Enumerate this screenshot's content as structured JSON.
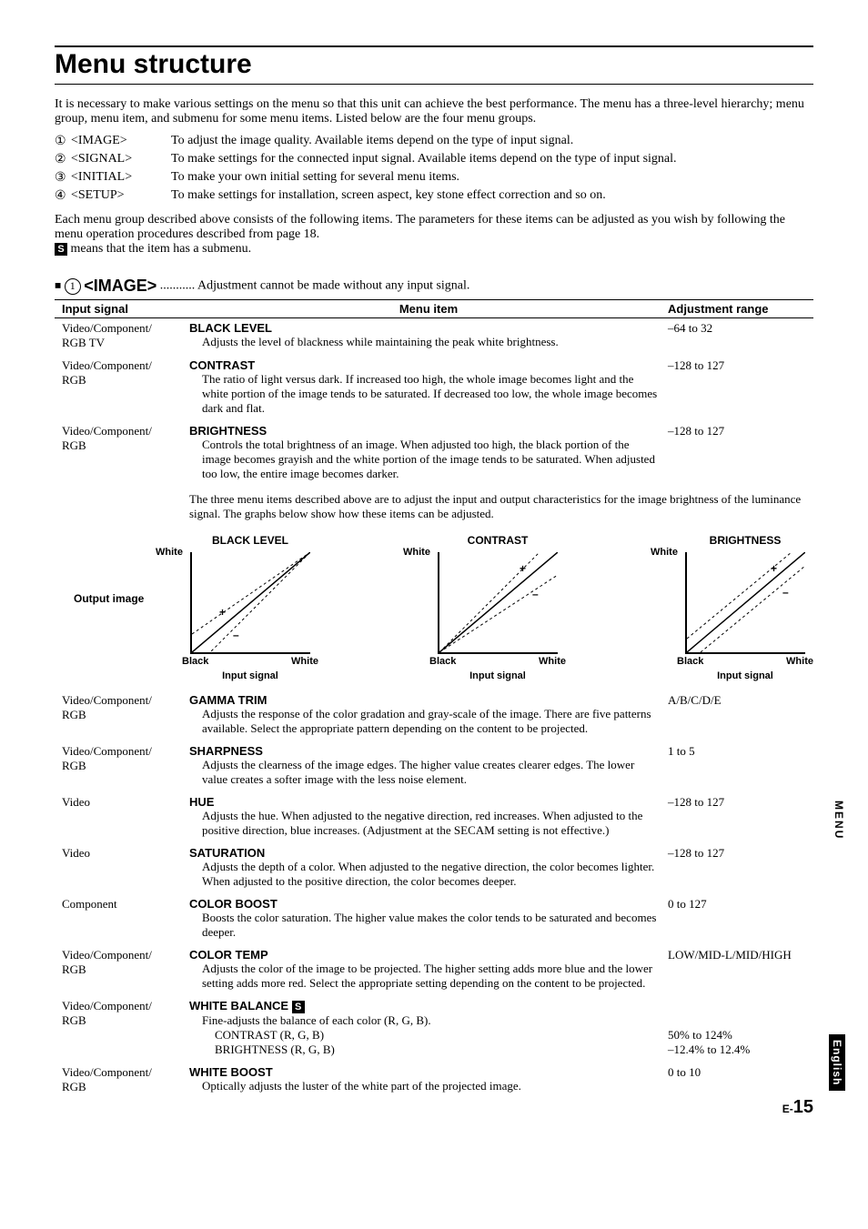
{
  "title": "Menu structure",
  "intro1": "It is necessary to make various settings on the menu so that this unit can achieve the best performance. The menu has a three-level hierarchy; menu group, menu item, and submenu for some menu items. Listed below are the four menu groups.",
  "groups": [
    {
      "num": "①",
      "tag": "<IMAGE>",
      "desc": "To adjust the image quality. Available items depend on the type of input signal."
    },
    {
      "num": "②",
      "tag": "<SIGNAL>",
      "desc": "To make settings for the connected input signal. Available items depend on the type of input signal."
    },
    {
      "num": "③",
      "tag": "<INITIAL>",
      "desc": "To make your own initial setting for several menu items."
    },
    {
      "num": "④",
      "tag": "<SETUP>",
      "desc": "To make settings for installation, screen aspect, key stone effect correction and so on."
    }
  ],
  "post1": "Each menu group described above consists of the following items. The parameters for these items can be adjusted as you wish by following the menu operation procedures described from page 18.",
  "post2": " means that the item has a submenu.",
  "section": {
    "num": "①",
    "name": "<IMAGE>",
    "dots": "...........",
    "note": "Adjustment cannot be made without any input signal."
  },
  "thead": {
    "c1": "Input signal",
    "c2": "Menu item",
    "c3": "Adjustment range"
  },
  "rows1": [
    {
      "input": "Video/Component/\nRGB TV",
      "title": "BLACK LEVEL",
      "desc": "Adjusts the level of blackness while maintaining the peak white brightness.",
      "range": "–64 to 32"
    },
    {
      "input": "Video/Component/\nRGB",
      "title": "CONTRAST",
      "desc": "The ratio of light versus dark. If increased too high, the whole image becomes light and the white portion of the image tends to be saturated. If decreased too low, the whole image becomes dark and flat.",
      "range": "–128 to 127"
    },
    {
      "input": "Video/Component/\nRGB",
      "title": "BRIGHTNESS",
      "desc": "Controls the total brightness of an image. When adjusted too high, the black portion of the image becomes grayish and the white portion of the image tends to be saturated. When adjusted too low, the entire image becomes darker.",
      "range": "–128 to 127"
    }
  ],
  "midnote": "The three menu items described above are to adjust the input and output characteristics for the image brightness of the luminance signal. The graphs below show how these items can be adjusted.",
  "chart_data": [
    {
      "type": "line",
      "title": "BLACK LEVEL",
      "xlabel": "Input signal",
      "ylabel": "Output image",
      "x": [
        "Black",
        "White"
      ],
      "ylim": [
        "Black",
        "White"
      ],
      "series": [
        {
          "name": "+",
          "values": [
            0.2,
            1.0
          ]
        },
        {
          "name": "base",
          "values": [
            0.0,
            1.0
          ]
        },
        {
          "name": "–",
          "values": [
            -0.2,
            1.0
          ]
        }
      ]
    },
    {
      "type": "line",
      "title": "CONTRAST",
      "xlabel": "Input signal",
      "ylabel": "",
      "x": [
        "Black",
        "White"
      ],
      "ylim": [
        "Black",
        "White"
      ],
      "series": [
        {
          "name": "+",
          "values": [
            0.0,
            1.2
          ]
        },
        {
          "name": "base",
          "values": [
            0.0,
            1.0
          ]
        },
        {
          "name": "–",
          "values": [
            0.0,
            0.8
          ]
        }
      ]
    },
    {
      "type": "line",
      "title": "BRIGHTNESS",
      "xlabel": "Input signal",
      "ylabel": "",
      "x": [
        "Black",
        "White"
      ],
      "ylim": [
        "Black",
        "White"
      ],
      "series": [
        {
          "name": "+",
          "values": [
            0.2,
            1.2
          ]
        },
        {
          "name": "base",
          "values": [
            0.0,
            1.0
          ]
        },
        {
          "name": "–",
          "values": [
            -0.2,
            0.8
          ]
        }
      ]
    }
  ],
  "charts": {
    "outLabel": "Output image",
    "white": "White",
    "black": "Black",
    "xlabel": "Input signal"
  },
  "rows2": [
    {
      "input": "Video/Component/\nRGB",
      "title": "GAMMA TRIM",
      "desc": "Adjusts the response of the color gradation and gray-scale of the image. There are five patterns available. Select the appropriate pattern depending on the content to be projected.",
      "range": "A/B/C/D/E"
    },
    {
      "input": "Video/Component/\nRGB",
      "title": "SHARPNESS",
      "desc": "Adjusts the clearness of the image edges. The higher value creates clearer edges. The lower value creates a softer image with the less noise element.",
      "range": "1 to 5"
    },
    {
      "input": "Video",
      "title": "HUE",
      "desc": "Adjusts the hue. When adjusted to the negative direction, red increases. When adjusted to the positive direction, blue increases. (Adjustment at the SECAM setting is not effective.)",
      "range": "–128 to 127"
    },
    {
      "input": "Video",
      "title": "SATURATION",
      "desc": "Adjusts the depth of a color. When adjusted to the negative direction, the color becomes lighter. When adjusted to the positive direction, the color becomes deeper.",
      "range": "–128 to 127"
    },
    {
      "input": "Component",
      "title": "COLOR BOOST",
      "desc": "Boosts the color saturation. The higher value makes the color tends to be saturated and becomes deeper.",
      "range": "0 to 127"
    },
    {
      "input": "Video/Component/\nRGB",
      "title": "COLOR TEMP",
      "desc": "Adjusts the color of the image to be projected. The higher setting adds more blue and the lower setting adds more red. Select the appropriate setting depending on the content to be projected.",
      "range": "LOW/MID-L/MID/HIGH"
    }
  ],
  "wb": {
    "input": "Video/Component/\nRGB",
    "title": "WHITE BALANCE ",
    "desc": "Fine-adjusts the balance of each color (R, G, B).",
    "sub1": "CONTRAST (R, G, B)",
    "sub2": "BRIGHTNESS (R, G, B)",
    "range1": "50% to 124%",
    "range2": "–12.4% to 12.4%"
  },
  "wboost": {
    "input": "Video/Component/\nRGB",
    "title": "WHITE BOOST",
    "desc": "Optically adjusts the luster of the white part of the projected image.",
    "range": "0 to 10"
  },
  "sideTab": "MENU",
  "sideTab2": "English",
  "pageE": "E-",
  "pageN": "15"
}
